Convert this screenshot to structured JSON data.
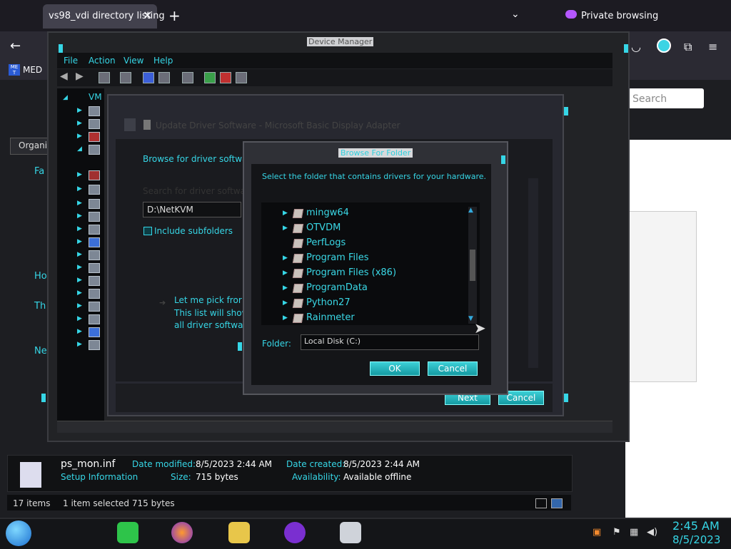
{
  "browser": {
    "tab_title": "vs98_vdi directory listing",
    "tab_close": "✕",
    "new_tab": "+",
    "tab_list": "⌄",
    "private_label": "Private browsing",
    "back": "←",
    "bookmark_label": "MED",
    "bookmark_icon_text": "ME T",
    "search_placeholder": "Search"
  },
  "devmgr": {
    "title": "Device Manager",
    "menu": [
      "File",
      "Action",
      "View",
      "Help"
    ],
    "tree_root": "VM"
  },
  "explorer": {
    "organize": "Organi",
    "left_items": [
      "Fa",
      "Ho",
      "Th",
      "Ne"
    ],
    "file_name": "ps_mon.inf",
    "file_type": "Setup Information",
    "date_modified_label": "Date modified:",
    "date_modified": "8/5/2023 2:44 AM",
    "size_label": "Size:",
    "size": "715 bytes",
    "date_created_label": "Date created:",
    "date_created": "8/5/2023 2:44 AM",
    "availability_label": "Availability:",
    "availability": "Available offline",
    "status_count": "17 items",
    "status_selection": "1 item selected  715 bytes"
  },
  "update_driver": {
    "title": "Update Driver Software - Microsoft Basic Display Adapter",
    "heading": "Browse for driver softwar",
    "search_label": "Search for driver softwar",
    "path": "D:\\NetKVM",
    "include_subfolders": "Include subfolders",
    "pick_line1": "Let me pick fror",
    "pick_line2": "This list will show",
    "pick_line3": "all driver softwa",
    "next": "Next",
    "cancel": "Cancel"
  },
  "browse_folder": {
    "title": "Browse For Folder",
    "instructions": "Select the folder that contains drivers for your hardware.",
    "folders": [
      {
        "name": "mingw64",
        "expandable": true
      },
      {
        "name": "OTVDM",
        "expandable": true
      },
      {
        "name": "PerfLogs",
        "expandable": false
      },
      {
        "name": "Program Files",
        "expandable": true
      },
      {
        "name": "Program Files (x86)",
        "expandable": true
      },
      {
        "name": "ProgramData",
        "expandable": true
      },
      {
        "name": "Python27",
        "expandable": true
      },
      {
        "name": "Rainmeter",
        "expandable": true
      }
    ],
    "folder_label": "Folder:",
    "folder_value": "Local Disk (C:)",
    "ok": "OK",
    "cancel": "Cancel"
  },
  "taskbar": {
    "time": "2:45 AM",
    "date": "8/5/2023"
  },
  "colors": {
    "accent": "#36d6e6",
    "button": "#1fb3bb",
    "private": "#b457ff"
  }
}
